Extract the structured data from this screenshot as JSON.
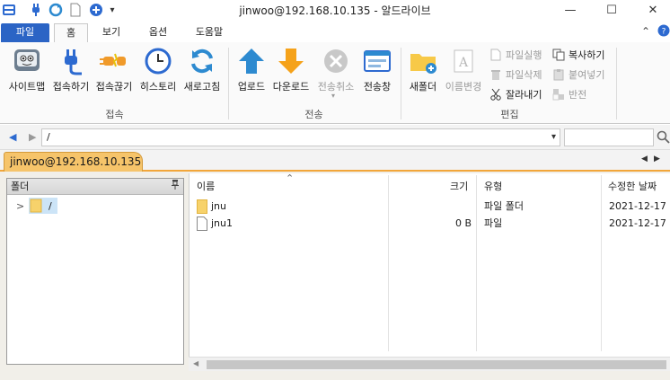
{
  "window": {
    "title": "jinwoo@192.168.10.135 - 알드라이브",
    "minimize_glyph": "—",
    "maximize_glyph": "☐",
    "close_glyph": "✕"
  },
  "quick_access": {
    "dropdown_glyph": "▾"
  },
  "ribbon_tabs": [
    {
      "label": "파일"
    },
    {
      "label": "홈"
    },
    {
      "label": "보기"
    },
    {
      "label": "옵션"
    },
    {
      "label": "도움말"
    }
  ],
  "ribbon_right": {
    "collapse_glyph": "⌃"
  },
  "ribbon": {
    "connect_group": {
      "label": "접속",
      "buttons": [
        {
          "label": "사이트맵"
        },
        {
          "label": "접속하기"
        },
        {
          "label": "접속끊기"
        },
        {
          "label": "히스토리"
        },
        {
          "label": "새로고침"
        }
      ]
    },
    "transfer_group": {
      "label": "전송",
      "buttons": [
        {
          "label": "업로드"
        },
        {
          "label": "다운로드"
        },
        {
          "label": "전송취소"
        },
        {
          "label": "전송창"
        }
      ]
    },
    "edit_group": {
      "label": "편집",
      "new_folder": "새폴더",
      "rename": "이름변경",
      "run_file": "파일실행",
      "delete_file": "파일삭제",
      "cut": "잘라내기",
      "copy": "복사하기",
      "paste": "붙여넣기",
      "invert": "반전"
    }
  },
  "address_bar": {
    "path": "/",
    "back_glyph": "◀",
    "forward_glyph": "▶",
    "dropdown_glyph": "▾"
  },
  "session": {
    "tab_label": "jinwoo@192.168.10.135",
    "nav_left": "◀",
    "nav_right": "▶"
  },
  "folder_pane": {
    "header": "폴더",
    "pin_glyph": "ᵖ",
    "tree_root": "/",
    "expand_glyph": ">"
  },
  "file_list": {
    "sort_glyph": "⌃",
    "columns": [
      "이름",
      "크기",
      "유형",
      "수정한 날짜"
    ],
    "rows": [
      {
        "name": "jnu",
        "size": "",
        "type": "파일 폴더",
        "date": "2021-12-17",
        "kind": "folder"
      },
      {
        "name": "jnu1",
        "size": "0 B",
        "type": "파일",
        "date": "2021-12-17",
        "kind": "file"
      }
    ]
  },
  "colors": {
    "accent_blue": "#2b64c5",
    "session_tab": "#f6c46a",
    "session_border": "#f2a63a",
    "folder_yellow": "#f7d26b"
  }
}
